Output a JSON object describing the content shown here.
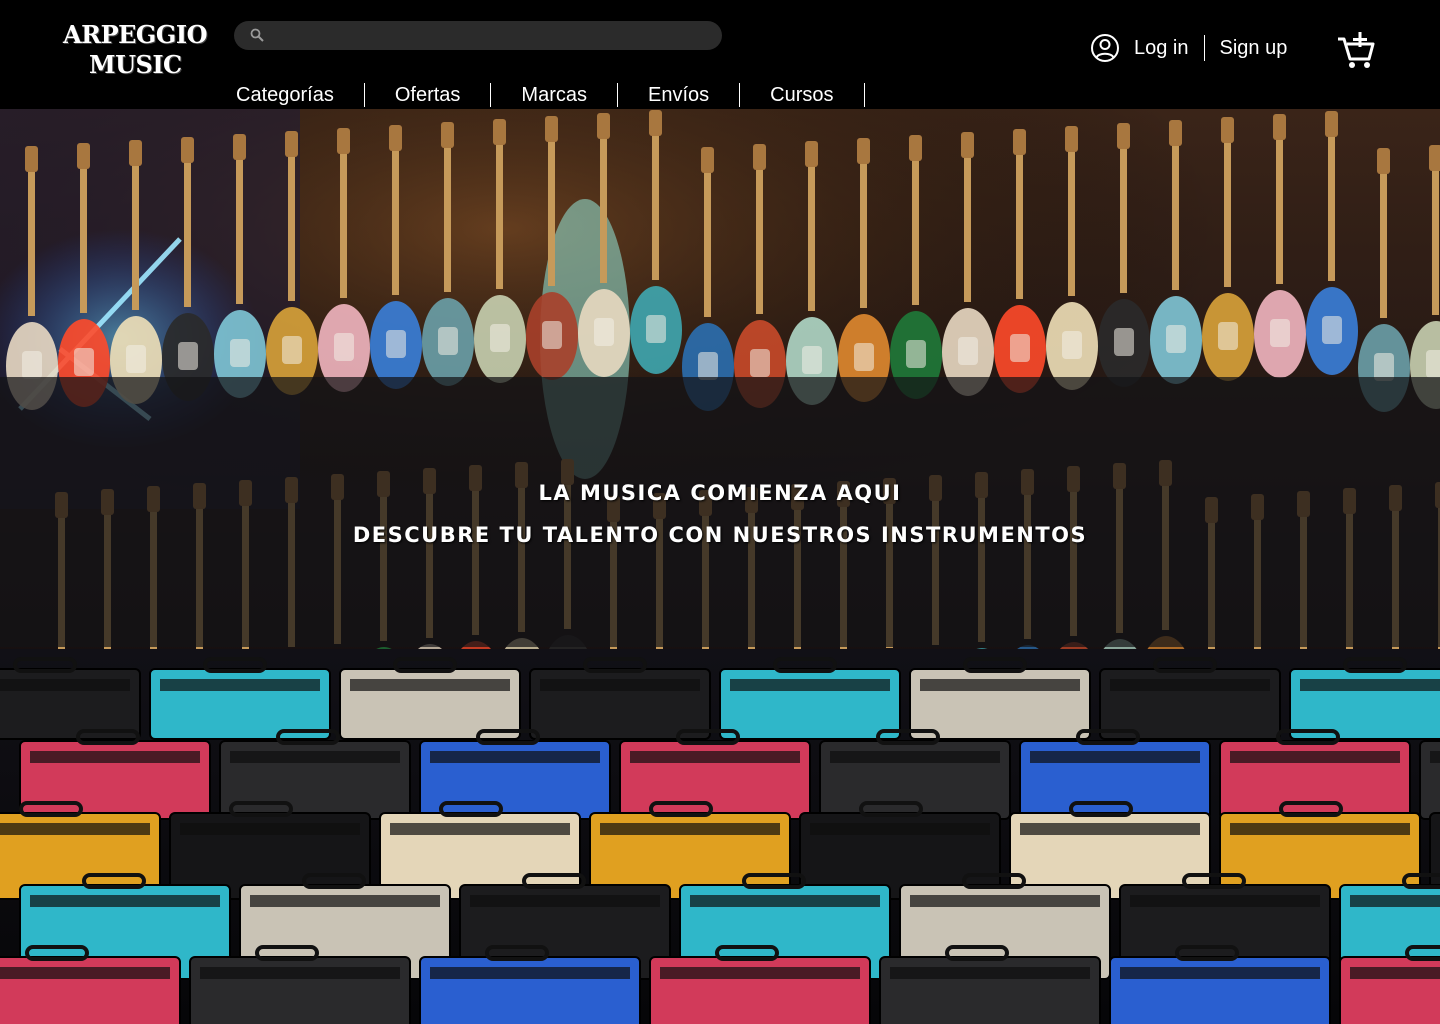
{
  "brand": {
    "line1": "Arpeggio",
    "line2": "Music"
  },
  "search": {
    "placeholder": "",
    "value": "",
    "icon": "search-icon"
  },
  "nav": {
    "items": [
      {
        "label": "Categorías"
      },
      {
        "label": "Ofertas"
      },
      {
        "label": "Marcas"
      },
      {
        "label": "Envíos"
      },
      {
        "label": "Cursos"
      }
    ]
  },
  "account": {
    "icon": "user-circle-icon",
    "login_label": "Log in",
    "signup_label": "Sign up"
  },
  "cart": {
    "icon": "cart-add-icon"
  },
  "hero": {
    "image": "music store interior with electric guitars on walls and amplifiers on the floor",
    "headline": "La musica comienza aqui",
    "subheadline": "Descubre tu talento con nuestros instrumentos"
  },
  "colors": {
    "header_bg": "#000000",
    "search_bg": "#2b2b2b",
    "banner_overlay": "rgba(20,20,22,0.72)",
    "text": "#ffffff"
  }
}
